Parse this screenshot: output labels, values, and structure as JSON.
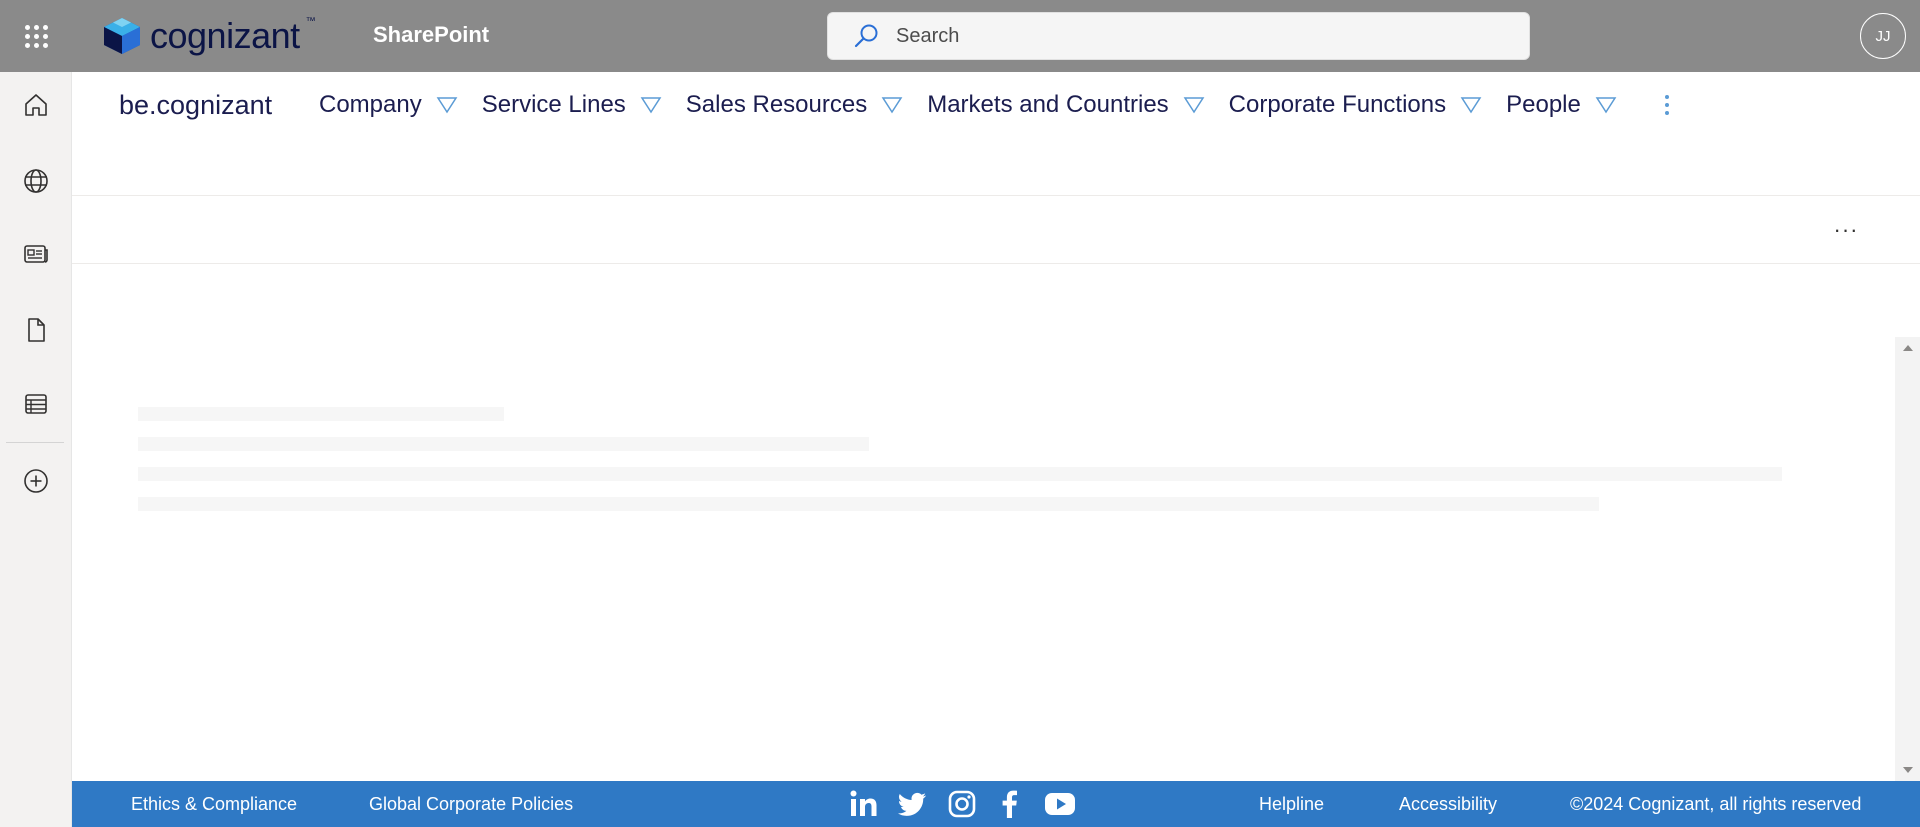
{
  "suite_bar": {
    "logo_text": "cognizant",
    "logo_mark": "™",
    "app_name": "SharePoint",
    "search_placeholder": "Search",
    "user_initials": "JJ",
    "colors": {
      "background": "#8a8a8a",
      "logo_text": "#0b1446"
    }
  },
  "app_bar": {
    "items": [
      {
        "icon": "home-icon"
      },
      {
        "icon": "globe-icon"
      },
      {
        "icon": "news-icon"
      },
      {
        "icon": "document-icon"
      },
      {
        "icon": "list-icon"
      },
      {
        "icon": "add-circle-icon"
      }
    ]
  },
  "site_header": {
    "site_title": "be.cognizant",
    "nav": [
      {
        "label": "Company"
      },
      {
        "label": "Service Lines"
      },
      {
        "label": "Sales Resources"
      },
      {
        "label": "Markets and Countries"
      },
      {
        "label": "Corporate Functions"
      },
      {
        "label": "People"
      }
    ],
    "more_icon": "vertical-ellipsis-icon",
    "colors": {
      "text": "#1b1d4f",
      "chevron": "#5b9bd5"
    }
  },
  "command_bar": {
    "more_label": "···"
  },
  "content": {
    "state": "loading-shimmer"
  },
  "footer": {
    "links_left": [
      "Ethics & Compliance",
      "Global Corporate Policies"
    ],
    "social": [
      "linkedin-icon",
      "twitter-icon",
      "instagram-icon",
      "facebook-icon",
      "youtube-icon"
    ],
    "links_right": [
      "Helpline",
      "Accessibility"
    ],
    "copyright": "©2024 Cognizant, all rights reserved",
    "colors": {
      "background": "#2f79c5",
      "text": "#ffffff"
    }
  }
}
